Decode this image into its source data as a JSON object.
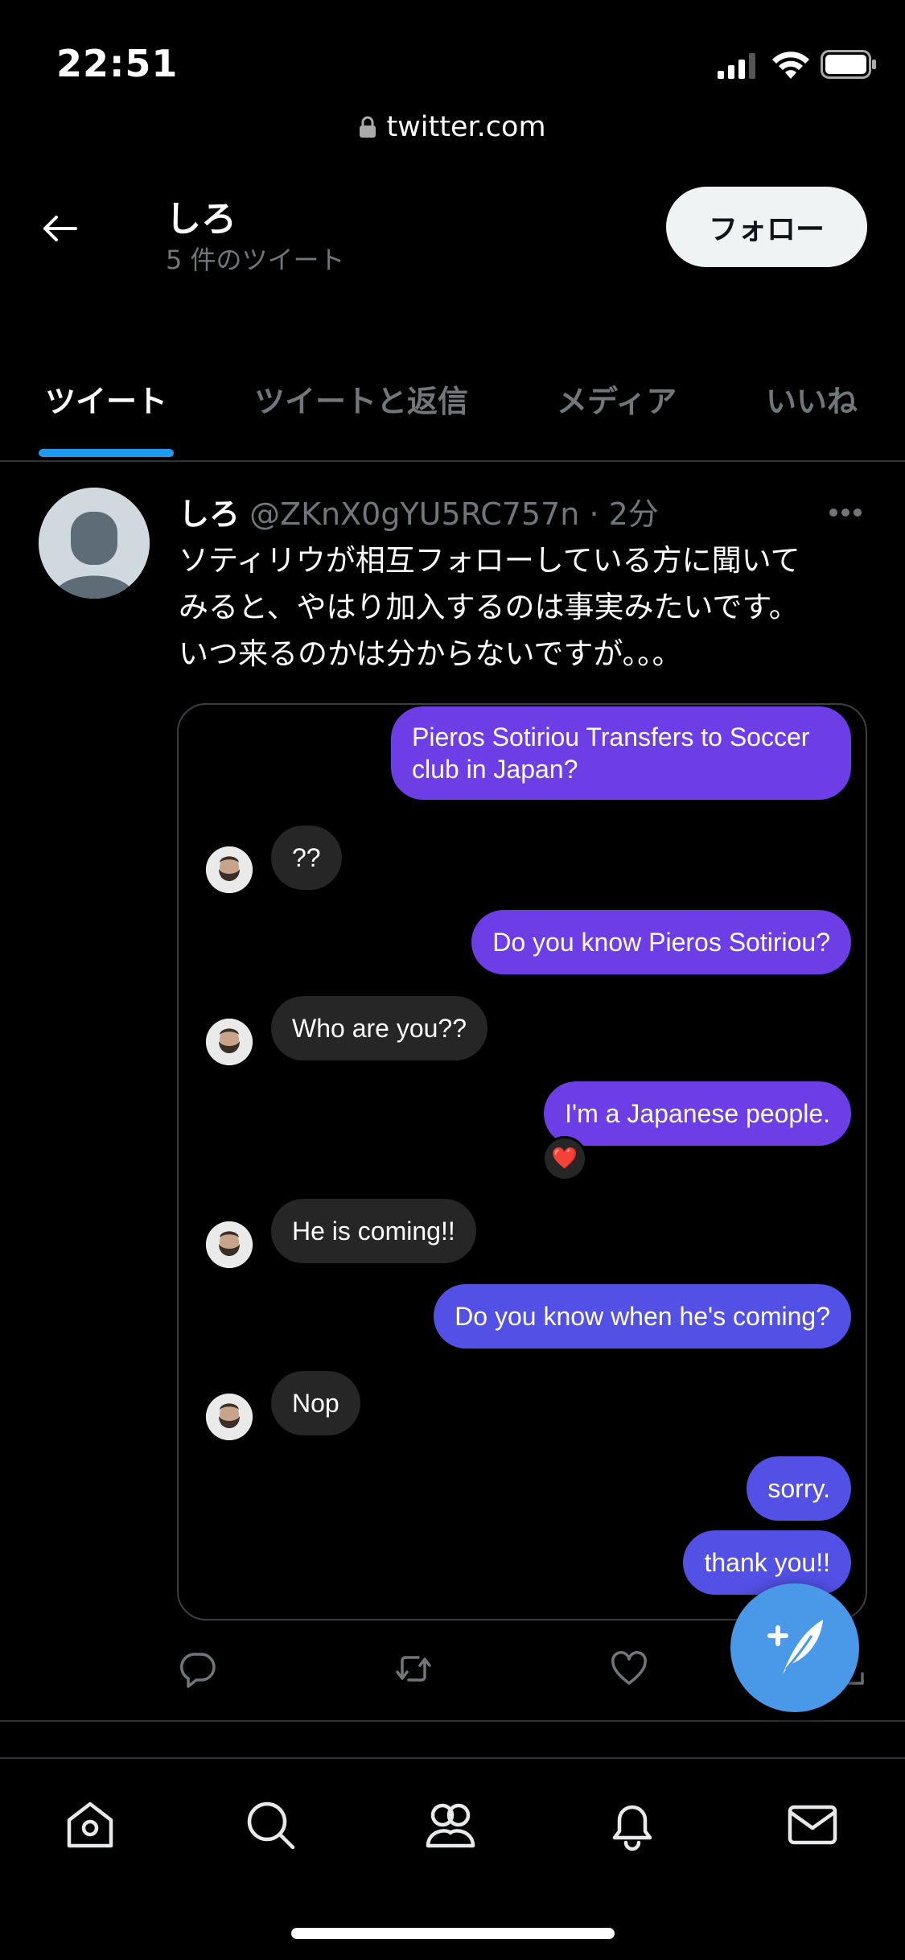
{
  "status_bar": {
    "time": "22:51",
    "url": "twitter.com"
  },
  "header": {
    "name": "しろ",
    "tweet_count": "5 件のツイート",
    "follow_label": "フォロー"
  },
  "tabs": [
    {
      "label": "ツイート",
      "active": true
    },
    {
      "label": "ツイートと返信",
      "active": false
    },
    {
      "label": "メディア",
      "active": false
    },
    {
      "label": "いいね",
      "active": false
    }
  ],
  "tweet": {
    "name": "しろ",
    "handle": "@ZKnX0gYU5RC757n",
    "separator": "·",
    "time": "2分",
    "text_lines": [
      "ソティリウが相互フォローしている方に聞いて",
      "みると、やはり加入するのは事実みたいです。",
      "いつ来るのかは分からないですが。。。"
    ],
    "chat": [
      {
        "side": "out",
        "lines": [
          "Pieros Sotiriou Transfers to Soccer",
          "club in Japan?"
        ]
      },
      {
        "side": "in",
        "text": "??"
      },
      {
        "side": "out",
        "text": "Do you know Pieros Sotiriou?"
      },
      {
        "side": "in",
        "text": "Who are you??"
      },
      {
        "side": "out",
        "text": "I'm a Japanese people.",
        "reaction": "❤️"
      },
      {
        "side": "in",
        "text": "He is coming!!"
      },
      {
        "side": "out",
        "text": "Do you know when he's coming?"
      },
      {
        "side": "in",
        "text": "Nop"
      },
      {
        "side": "out",
        "text": "sorry."
      },
      {
        "side": "out",
        "text": "thank you!!"
      }
    ]
  },
  "icons": {
    "bottom_nav": [
      "home-icon",
      "search-icon",
      "communities-icon",
      "notifications-icon",
      "messages-icon"
    ],
    "actions": [
      "reply-icon",
      "retweet-icon",
      "like-icon",
      "share-icon"
    ]
  },
  "colors": {
    "accent": "#1d9bf0",
    "fab": "#4a99e9",
    "bubble_out_purple": "#6d3ee6",
    "bubble_out_blue": "#5350e6",
    "bubble_in": "#262626"
  }
}
